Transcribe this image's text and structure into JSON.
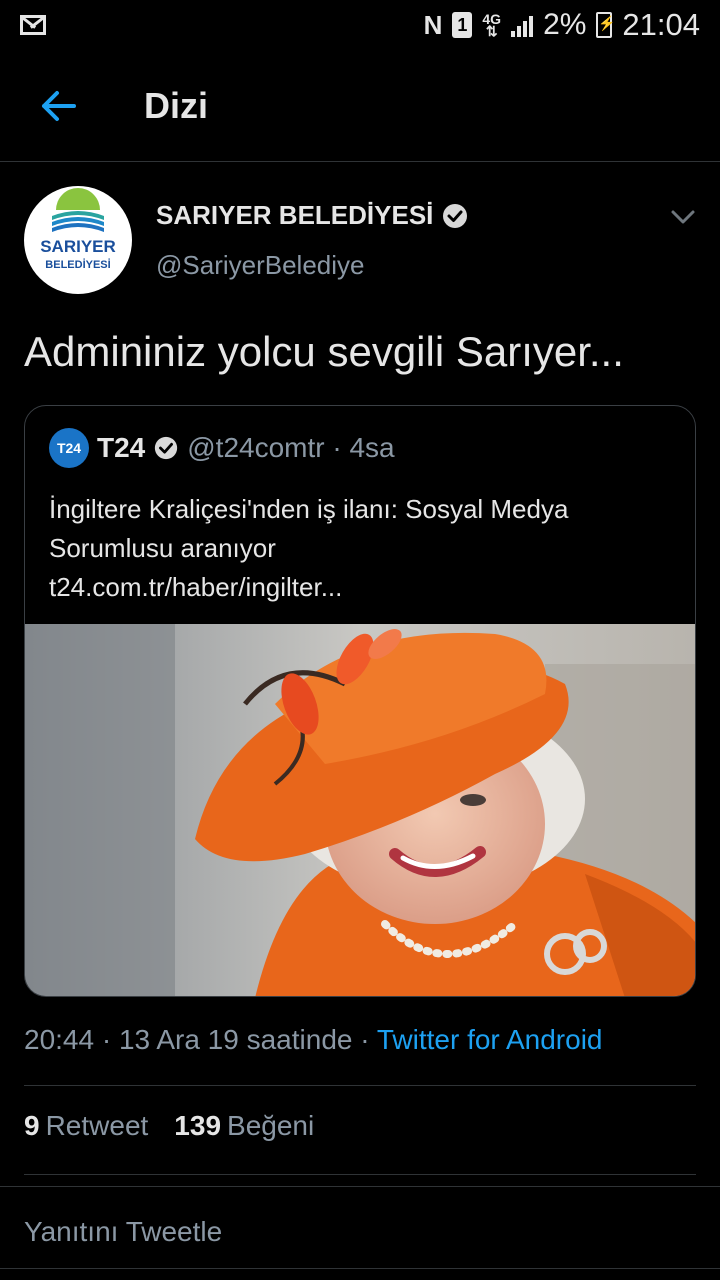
{
  "status_bar": {
    "icons": [
      "mail-icon",
      "nfc-icon",
      "sim-icon",
      "network-4g-icon",
      "signal-icon",
      "battery-charging-icon"
    ],
    "nfc": "N",
    "sim": "1",
    "net_top": "4G",
    "net_bottom": "⇅",
    "battery": "2%",
    "time": "21:04"
  },
  "header": {
    "back_icon": "arrow-left-icon",
    "title": "Dizi"
  },
  "tweet": {
    "author_name": "SARIYER BELEDİYESİ",
    "author_handle": "@SariyerBelediye",
    "avatar_top": "SARIYER",
    "avatar_bottom": "BELEDİYESİ",
    "text": "Admininiz yolcu sevgili Sarıyer...",
    "timestamp": "20:44 · 13 Ara 19 saatinde · ",
    "source": "Twitter for Android",
    "retweets_count": "9",
    "retweets_label": "Retweet",
    "likes_count": "139",
    "likes_label": "Beğeni",
    "reply_placeholder": "Yanıtını Tweetle"
  },
  "quote": {
    "avatar_text": "T24",
    "name": "T24",
    "handle_time": "@t24comtr · 4sa",
    "text_lines": [
      "İngiltere Kraliçesi'nden iş ilanı: Sosyal Medya",
      "Sorumlusu aranıyor",
      "t24.com.tr/haber/ingilter..."
    ]
  },
  "colors": {
    "background": "#000000",
    "accent": "#1da1f2",
    "muted": "#8b98a5",
    "orange": "#e8661b"
  }
}
